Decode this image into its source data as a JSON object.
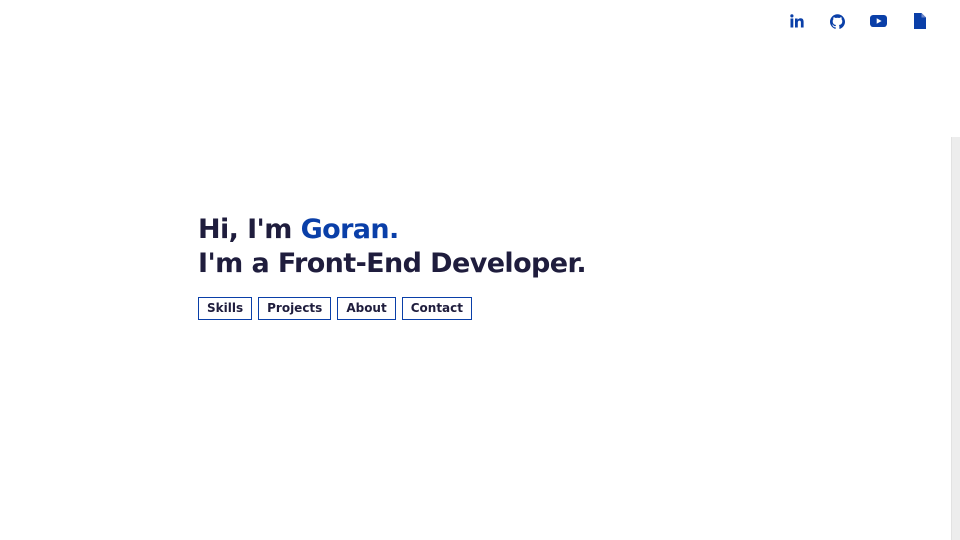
{
  "social": [
    {
      "name": "linkedin",
      "icon": "linkedin-icon"
    },
    {
      "name": "github",
      "icon": "github-icon"
    },
    {
      "name": "youtube",
      "icon": "youtube-icon"
    },
    {
      "name": "resume",
      "icon": "document-icon"
    }
  ],
  "hero": {
    "greeting_prefix": "Hi, I'm ",
    "name": "Goran.",
    "tagline": "I'm a Front-End Developer."
  },
  "nav": {
    "skills": "Skills",
    "projects": "Projects",
    "about": "About",
    "contact": "Contact"
  },
  "colors": {
    "accent": "#0a3fa8",
    "text": "#1f1d3d",
    "background": "#ffffff"
  }
}
